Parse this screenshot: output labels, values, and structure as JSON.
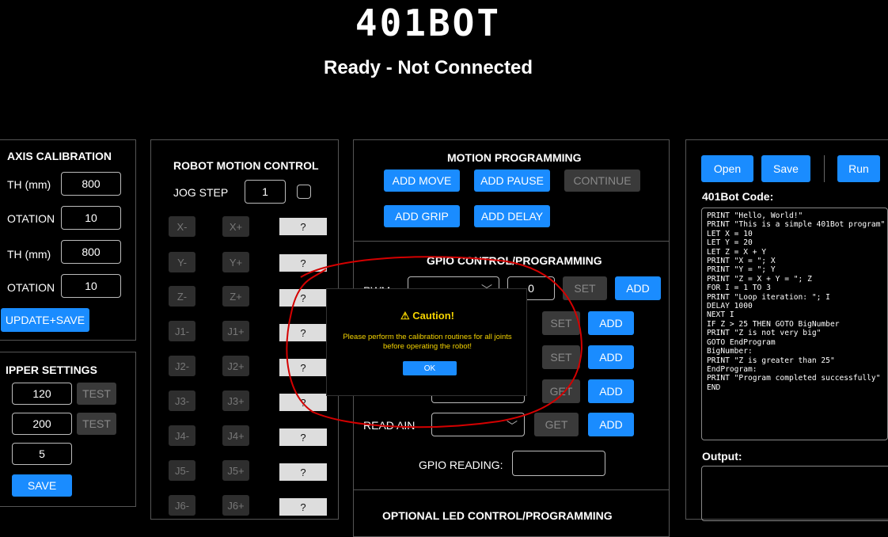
{
  "header": {
    "logo": "401BOT",
    "status": "Ready - Not Connected"
  },
  "axis_calibration": {
    "title": "AXIS CALIBRATION",
    "rows": [
      {
        "label": "TH (mm)",
        "value": "800"
      },
      {
        "label": "OTATION",
        "value": "10"
      },
      {
        "label": "TH (mm)",
        "value": "800"
      },
      {
        "label": "OTATION",
        "value": "10"
      }
    ],
    "button": "UPDATE+SAVE"
  },
  "gripper_settings": {
    "title": "IPPER SETTINGS",
    "rows": [
      {
        "value": "120",
        "test": "TEST"
      },
      {
        "value": "200",
        "test": "TEST"
      },
      {
        "value": "5"
      }
    ],
    "save": "SAVE"
  },
  "motion_control": {
    "title": "ROBOT MOTION CONTROL",
    "jog_step_label": "JOG STEP",
    "jog_step_value": "1",
    "rows": [
      {
        "minus": "X-",
        "plus": "X+",
        "q": "?"
      },
      {
        "minus": "Y-",
        "plus": "Y+",
        "q": "?"
      },
      {
        "minus": "Z-",
        "plus": "Z+",
        "q": "?"
      },
      {
        "minus": "J1-",
        "plus": "J1+",
        "q": "?"
      },
      {
        "minus": "J2-",
        "plus": "J2+",
        "q": "?"
      },
      {
        "minus": "J3-",
        "plus": "J3+",
        "q": "?"
      },
      {
        "minus": "J4-",
        "plus": "J4+",
        "q": "?"
      },
      {
        "minus": "J5-",
        "plus": "J5+",
        "q": "?"
      },
      {
        "minus": "J6-",
        "plus": "J6+",
        "q": "?"
      }
    ]
  },
  "motion_programming": {
    "title": "MOTION PROGRAMMING",
    "add_move": "ADD MOVE",
    "add_pause": "ADD PAUSE",
    "continue": "CONTINUE",
    "add_grip": "ADD GRIP",
    "add_delay": "ADD DELAY"
  },
  "gpio": {
    "title": "GPIO CONTROL/PROGRAMMING",
    "pwm_label": "PWM",
    "pwm_value": "0",
    "set": "SET",
    "get": "GET",
    "add": "ADD",
    "read_ain_label": "READ AIN",
    "gpio_reading_label": "GPIO READING:"
  },
  "led_panel": {
    "title": "OPTIONAL LED CONTROL/PROGRAMMING"
  },
  "code_panel": {
    "open": "Open",
    "save": "Save",
    "run": "Run",
    "code_label": "401Bot Code:",
    "code": "PRINT \"Hello, World!\"\nPRINT \"This is a simple 401Bot program\"\nLET X = 10\nLET Y = 20\nLET Z = X + Y\nPRINT \"X = \"; X\nPRINT \"Y = \"; Y\nPRINT \"Z = X + Y = \"; Z\nFOR I = 1 TO 3\nPRINT \"Loop iteration: \"; I\nDELAY 1000\nNEXT I\nIF Z > 25 THEN GOTO BigNumber\nPRINT \"Z is not very big\"\nGOTO EndProgram\nBigNumber:\nPRINT \"Z is greater than 25\"\nEndProgram:\nPRINT \"Program completed successfully\"\nEND",
    "output_label": "Output:"
  },
  "modal": {
    "title": "⚠ Caution!",
    "message": "Please perform the calibration routines for all joints before operating the robot!",
    "ok": "OK"
  },
  "colors": {
    "accent": "#1a8cff",
    "warning": "#f5d400",
    "annotation": "#d40000"
  }
}
